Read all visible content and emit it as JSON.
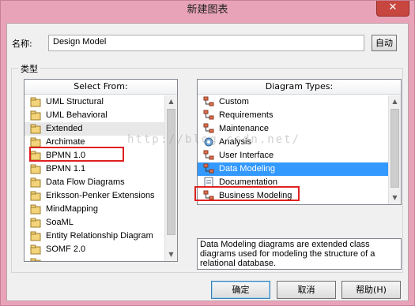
{
  "window": {
    "title": "新建图表",
    "close_glyph": "✕"
  },
  "name_label": "名称:",
  "name_value": "Design Model",
  "auto_button": "自动",
  "group_label": "类型",
  "left_panel": {
    "header": "Select From:",
    "items": [
      {
        "label": "UML Structural",
        "icon": "package-icon"
      },
      {
        "label": "UML Behavioral",
        "icon": "package-icon"
      },
      {
        "label": "Extended",
        "icon": "package-icon"
      },
      {
        "label": "Archimate",
        "icon": "package-icon"
      },
      {
        "label": "BPMN 1.0",
        "icon": "package-icon"
      },
      {
        "label": "BPMN 1.1",
        "icon": "package-icon"
      },
      {
        "label": "Data Flow Diagrams",
        "icon": "package-icon"
      },
      {
        "label": "Eriksson-Penker Extensions",
        "icon": "package-icon"
      },
      {
        "label": "MindMapping",
        "icon": "package-icon"
      },
      {
        "label": "SoaML",
        "icon": "package-icon"
      },
      {
        "label": "Entity Relationship Diagram",
        "icon": "package-icon"
      },
      {
        "label": "SOMF 2.0",
        "icon": "package-icon"
      },
      {
        "label": "",
        "icon": "package-icon"
      }
    ],
    "selected_index": 2,
    "scroll_position": 0.0
  },
  "right_panel": {
    "header": "Diagram Types:",
    "items": [
      {
        "label": "Custom",
        "icon": "diagram-icon"
      },
      {
        "label": "Requirements",
        "icon": "diagram-icon"
      },
      {
        "label": "Maintenance",
        "icon": "diagram-icon"
      },
      {
        "label": "Analysis",
        "icon": "analysis-icon"
      },
      {
        "label": "User Interface",
        "icon": "diagram-icon"
      },
      {
        "label": "Data Modeling",
        "icon": "diagram-icon"
      },
      {
        "label": "Documentation",
        "icon": "document-icon"
      },
      {
        "label": "Business Modeling",
        "icon": "diagram-icon"
      }
    ],
    "selected_index": 5
  },
  "description": "Data Modeling diagrams are extended class diagrams used for modeling the structure of a relational database.",
  "buttons": {
    "ok": "确定",
    "cancel": "取消",
    "help": "帮助(H)"
  },
  "watermark": "http://blog.csdn.net/",
  "colors": {
    "selection": "#3399ff",
    "highlight_box": "#e02020",
    "titlebar": "#e9a3b8"
  }
}
